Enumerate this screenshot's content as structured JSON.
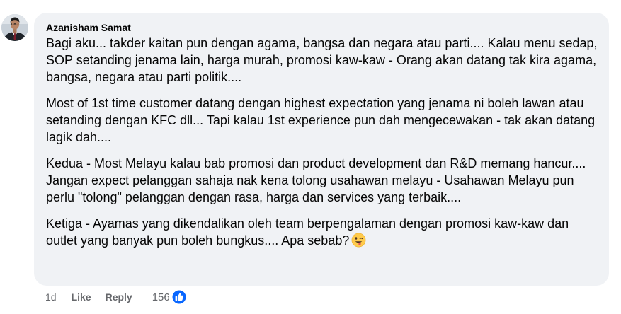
{
  "comment": {
    "author": "Azanisham Samat",
    "paragraphs": [
      "Bagi aku... takder kaitan pun dengan agama, bangsa dan negara atau parti.... Kalau menu sedap, SOP setanding jenama lain, harga murah, promosi kaw-kaw - Orang akan datang tak kira agama, bangsa, negara atau parti politik....",
      "Most of 1st time customer datang dengan highest expectation yang jenama ni boleh lawan atau setanding dengan KFC dll... Tapi kalau 1st experience pun dah mengecewakan - tak akan datang lagik dah....",
      "Kedua - Most Melayu kalau bab promosi dan product development dan R&D memang hancur.... Jangan expect pelanggan sahaja nak kena tolong usahawan melayu - Usahawan Melayu pun perlu \"tolong\" pelanggan dengan rasa, harga dan services yang terbaik....",
      "Ketiga - Ayamas yang dikendalikan oleh team berpengalaman dengan promosi kaw-kaw dan outlet yang banyak pun boleh bungkus.... Apa sebab?"
    ],
    "trailing_emoji": "winking-face-with-tongue-emoji",
    "time": "1d",
    "like_label": "Like",
    "reply_label": "Reply",
    "reaction_count": "156",
    "reaction_icon": "like-icon"
  },
  "colors": {
    "bubble_bg": "#f0f2f5",
    "text": "#050505",
    "secondary_text": "#65676b",
    "like_blue": "#0866ff"
  }
}
